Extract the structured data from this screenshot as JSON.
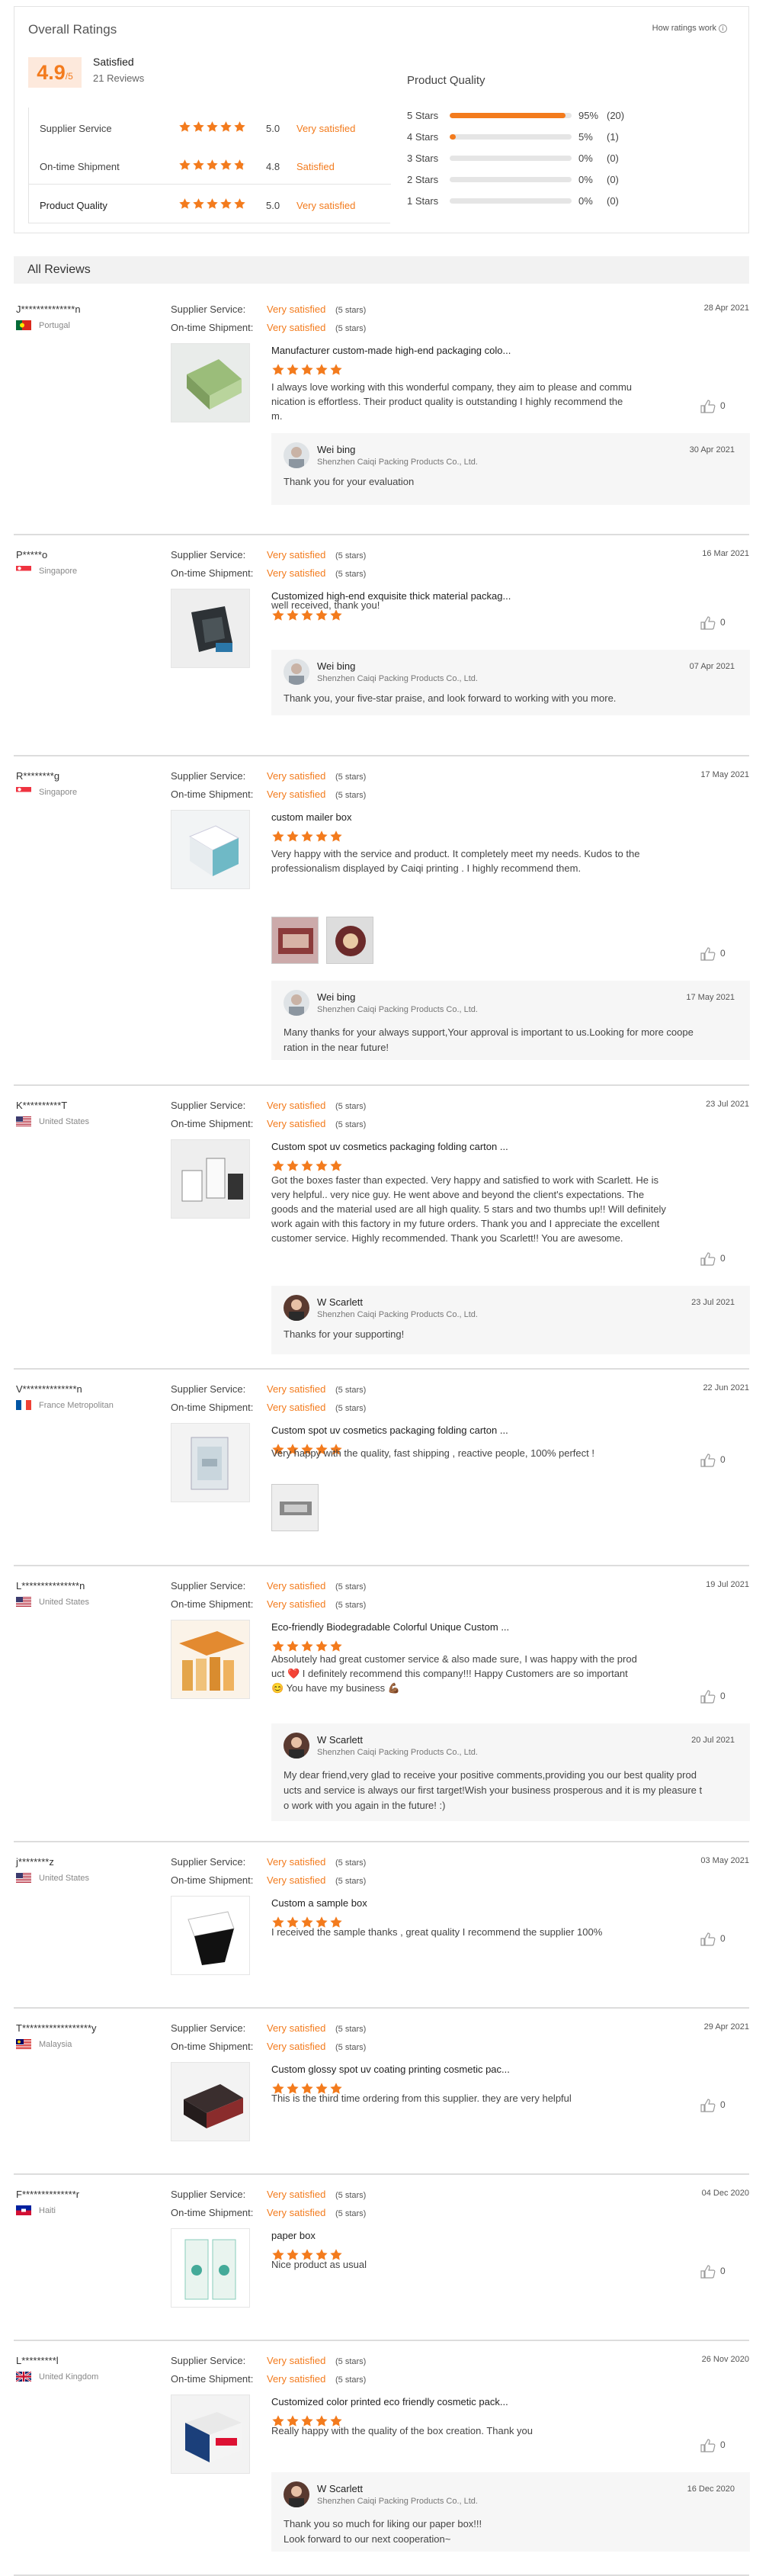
{
  "overall": {
    "title": "Overall Ratings",
    "how_link": "How ratings work",
    "score": "4.9",
    "score_max": "/5",
    "satisfaction": "Satisfied",
    "reviews_count": "21 Reviews",
    "criteria": [
      {
        "label": "Supplier Service",
        "value": "5.0",
        "stars": 5,
        "level": "Very satisfied"
      },
      {
        "label": "On-time Shipment",
        "value": "4.8",
        "stars": 4.8,
        "level": "Satisfied"
      },
      {
        "label": "Product Quality",
        "value": "5.0",
        "stars": 5,
        "level": "Very satisfied"
      }
    ],
    "product_quality": {
      "title": "Product Quality",
      "rows": [
        {
          "label": "5 Stars",
          "pct": "95%",
          "count": "(20)",
          "fill": 0.95
        },
        {
          "label": "4 Stars",
          "pct": "5%",
          "count": "(1)",
          "fill": 0.05
        },
        {
          "label": "3 Stars",
          "pct": "0%",
          "count": "(0)",
          "fill": 0
        },
        {
          "label": "2 Stars",
          "pct": "0%",
          "count": "(0)",
          "fill": 0
        },
        {
          "label": "1 Stars",
          "pct": "0%",
          "count": "(0)",
          "fill": 0
        }
      ]
    }
  },
  "all_reviews_title": "All Reviews",
  "labels": {
    "supplier_service": "Supplier Service:",
    "on_time": "On-time Shipment:",
    "very_satisfied": "Very satisfied",
    "five_stars": "(5 stars)",
    "company": "Shenzhen Caiqi Packing Products Co., Ltd."
  },
  "reviews": [
    {
      "name": "J**************n",
      "country": "Portugal",
      "flag": "pt",
      "date": "28 Apr 2021",
      "product": "Manufacturer custom-made high-end packaging colo...",
      "text": [
        "I always love working with this wonderful company, they aim to please and commu",
        "nication is effortless.  Their product quality is outstanding I highly recommend the",
        "m."
      ],
      "likes": "0",
      "reply": {
        "name": "Wei bing",
        "date": "30 Apr 2021",
        "text": [
          "Thank you for your evaluation"
        ]
      }
    },
    {
      "name": "P*****o",
      "country": "Singapore",
      "flag": "sg",
      "date": "16 Mar 2021",
      "product": "Customized high-end exquisite thick material packag...",
      "text": [
        "well received, thank you!"
      ],
      "likes": "0",
      "reply": {
        "name": "Wei bing",
        "date": "07 Apr 2021",
        "text": [
          "Thank you, your five-star praise, and look forward to working with you more."
        ]
      }
    },
    {
      "name": "R********g",
      "country": "Singapore",
      "flag": "sg",
      "date": "17 May 2021",
      "product": "custom mailer box",
      "text": [
        "Very happy with the service and product. It completely meet my needs. Kudos to the",
        "professionalism displayed by Caiqi printing . I highly recommend them."
      ],
      "likes": "0",
      "reply": {
        "name": "Wei bing",
        "date": "17 May 2021",
        "text": [
          "Many thanks for your always support,Your approval is important to us.Looking for more coope",
          "ration in the near future!"
        ]
      }
    },
    {
      "name": "K**********T",
      "country": "United States",
      "flag": "us",
      "date": "23 Jul 2021",
      "product": "Custom spot uv cosmetics packaging folding carton ...",
      "text": [
        "Got the boxes faster than expected. Very happy and satisfied to work with Scarlett. He is",
        "very helpful.. very nice guy. He went above and beyond the client's expectations. The",
        "goods and the material used are all high quality. 5 stars and two thumbs up!! Will definitely",
        "work again with this factory in my future orders. Thank you and I appreciate the excellent",
        "customer service. Highly recommended. Thank you Scarlett!! You are awesome."
      ],
      "likes": "0",
      "reply": {
        "name": "W Scarlett",
        "date": "23 Jul 2021",
        "text": [
          "Thanks for your supporting!"
        ]
      }
    },
    {
      "name": "V**************n",
      "country": "France Metropolitan",
      "flag": "fr",
      "date": "22 Jun 2021",
      "product": "Custom spot uv cosmetics packaging folding carton ...",
      "text": [
        "Very happy with the quality, fast shipping , reactive people, 100% perfect !"
      ],
      "likes": "0"
    },
    {
      "name": "L***************n",
      "country": "United States",
      "flag": "us",
      "date": "19 Jul 2021",
      "product": "Eco-friendly Biodegradable Colorful Unique Custom ...",
      "text": [
        "Absolutely had great customer service & also made sure, I was happy with the prod",
        "uct ❤️ I definitely recommend this company!!! Happy Customers are so important",
        "😊 You have my business 💪🏾"
      ],
      "likes": "0",
      "reply": {
        "name": "W Scarlett",
        "date": "20 Jul 2021",
        "text": [
          "My dear friend,very glad to receive your positive comments,providing you our best quality prod",
          "ucts and service is always our first target!Wish your business prosperous and it is my pleasure t",
          "o work with you again in the future! :)"
        ]
      }
    },
    {
      "name": "j********z",
      "country": "United States",
      "flag": "us",
      "date": "03 May 2021",
      "product": "Custom a sample box",
      "text": [
        "I received the sample thanks , great quality I recommend the supplier 100%"
      ],
      "likes": "0"
    },
    {
      "name": "T******************y",
      "country": "Malaysia",
      "flag": "my",
      "date": "29 Apr 2021",
      "product": "Custom glossy spot uv coating printing cosmetic pac...",
      "text": [
        "This is the third time ordering from this supplier. they are very helpful"
      ],
      "likes": "0"
    },
    {
      "name": "F**************r",
      "country": "Haiti",
      "flag": "ht",
      "date": "04 Dec 2020",
      "product": "paper box",
      "text": [
        "Nice product as usual"
      ],
      "likes": "0"
    },
    {
      "name": "L*********l",
      "country": "United Kingdom",
      "flag": "gb",
      "date": "26 Nov 2020",
      "product": "Customized color printed eco friendly cosmetic pack...",
      "text": [
        "Really happy with the quality of the box creation. Thank you"
      ],
      "likes": "0",
      "reply": {
        "name": "W Scarlett",
        "date": "16 Dec 2020",
        "text": [
          "Thank you so much for liking our paper box!!!",
          "Look forward to our next cooperation~"
        ]
      }
    }
  ]
}
